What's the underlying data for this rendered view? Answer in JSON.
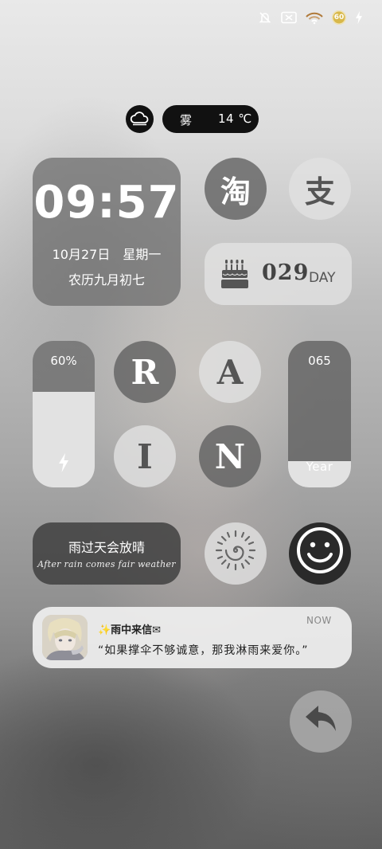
{
  "status_bar": {
    "icons": [
      "mute-vibrate-icon",
      "no-sim-icon",
      "wifi-icon",
      "battery-icon",
      "charging-bolt-icon"
    ],
    "battery_level": "60"
  },
  "weather": {
    "icon": "cloud-icon",
    "condition": "雾",
    "temperature": "14 ℃"
  },
  "clock": {
    "time": "09:57",
    "date": "10月27日",
    "weekday": "星期一",
    "lunar": "农历九月初七"
  },
  "apps": {
    "taobao_glyph": "淘",
    "alipay_glyph": "支"
  },
  "day_counter": {
    "icon": "birthday-cake-icon",
    "value": "029",
    "unit": "DAY"
  },
  "battery_widget": {
    "percent_label": "60%",
    "level": 0.6,
    "icon": "charging-bolt-icon"
  },
  "rain_letters": [
    "R",
    "A",
    "I",
    "N"
  ],
  "year_widget": {
    "value": "065",
    "label": "Year",
    "progress": 0.18
  },
  "quote": {
    "text_cn": "雨过天会放晴",
    "text_en": "After rain comes fair weather"
  },
  "icons": {
    "sun": "sun-icon",
    "smile": "smiley-icon",
    "back": "back-arrow-icon"
  },
  "notification": {
    "title": "✨雨中来信✉",
    "time": "NOW",
    "body": "“如果撑伞不够诚意，那我淋雨来爱你。”"
  },
  "colors": {
    "dark_widget": "#5f5f5f",
    "light_widget": "#e1e1e1",
    "pill": "#111111",
    "battery_badge": "#d8b84a"
  }
}
